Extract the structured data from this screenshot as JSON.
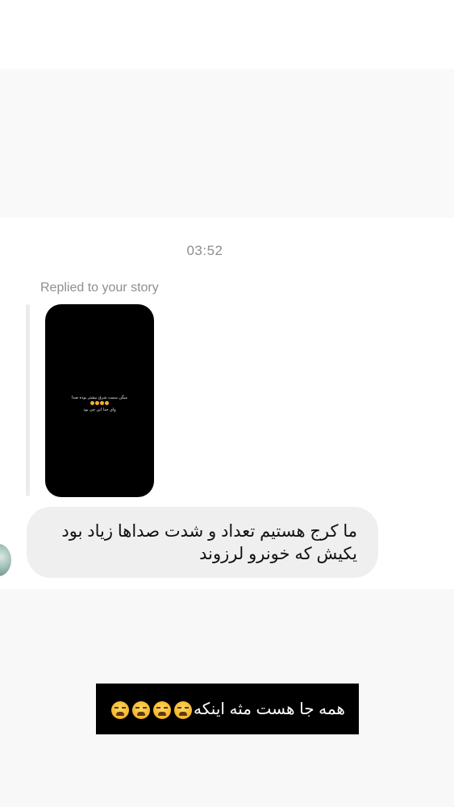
{
  "header": {},
  "conversation": {
    "timestamp": "03:52",
    "reply_label": "Replied to your story",
    "story_preview": {
      "line1": "میگن سمت شرق بیشتر بوده صدا",
      "line3": "وای خدا این چی بود",
      "emoji_count": 4
    },
    "message": {
      "text": "ما کرج هستیم تعداد و شدت صداها زیاد بود\nیکیش که خونرو لرزوند"
    }
  },
  "caption": {
    "text": "همه جا هست مثه اینکه",
    "emoji_count": 4,
    "emoji_name": "weary-face"
  }
}
